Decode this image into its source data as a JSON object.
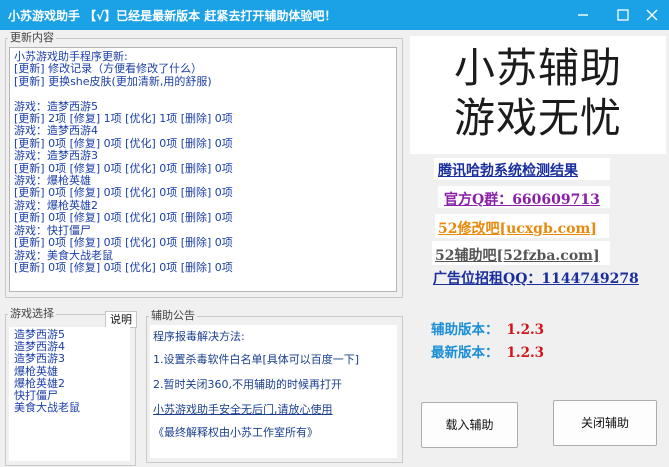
{
  "window": {
    "title": "小苏游戏助手 【√】已经是最新版本 赶紧去打开辅助体验吧！",
    "minimize_icon": "minimize-icon",
    "maximize_icon": "maximize-icon",
    "close_icon": "close-icon"
  },
  "update_panel": {
    "legend": "更新内容",
    "lines": [
      "小苏游戏助手程序更新:",
      "[更新] 修改记录（方便看修改了什么）",
      "[更新] 更换she皮肤(更加清新,用的舒服)",
      "",
      "游戏：造梦西游5",
      "[更新] 2项 [修复] 1项 [优化] 1项 [删除] 0项",
      "游戏：造梦西游4",
      "[更新] 0项 [修复] 0项 [优化] 0项 [删除] 0项",
      "游戏：造梦西游3",
      "[更新] 0项 [修复] 0项 [优化] 0项 [删除] 0项",
      "游戏：爆枪英雄",
      "[更新] 0项 [修复] 0项 [优化] 0项 [删除] 0项",
      "游戏：爆枪英雄2",
      "[更新] 0项 [修复] 0项 [优化] 0项 [删除] 0项",
      "游戏：快打僵尸",
      "[更新] 0项 [修复] 0项 [优化] 0项 [删除] 0项",
      "游戏：美食大战老鼠",
      "[更新] 0项 [修复] 0项 [优化] 0项 [删除] 0项"
    ]
  },
  "banner": {
    "line1": "小苏辅助",
    "line2": "游戏无忧"
  },
  "links": {
    "detection": "腾讯哈勃系统检测结果",
    "qq_group": "官方Q群：660609713",
    "site1": "52修改吧[ucxgb.com]",
    "site2": "52辅助吧[52fzba.com]",
    "ad": "广告位招租QQ：1144749278"
  },
  "game_select": {
    "legend": "游戏选择",
    "help_label": "说明",
    "games": [
      "造梦西游5",
      "造梦西游4",
      "造梦西游3",
      "爆枪英雄",
      "爆枪英雄2",
      "快打僵尸",
      "美食大战老鼠"
    ]
  },
  "notice": {
    "legend": "辅助公告",
    "line1": "程序报毒解决方法:",
    "line2": "1.设置杀毒软件白名单[具体可以百度一下]",
    "line3": "2.暂时关闭360,不用辅助的时候再打开",
    "line4": "小苏游戏助手安全无后门,请放心使用",
    "line5": "《最终解释权由小苏工作室所有》"
  },
  "version": {
    "aux_label": "辅助版本：",
    "aux_value": "1.2.3",
    "latest_label": "最新版本：",
    "latest_value": "1.2.3"
  },
  "buttons": {
    "load": "载入辅助",
    "close": "关闭辅助"
  },
  "colors": {
    "titlebar": "#1aa1e6",
    "text_blue": "#1c3fa8",
    "red": "#d4131a",
    "purple": "#8a1fa8",
    "orange": "#e8890b"
  }
}
